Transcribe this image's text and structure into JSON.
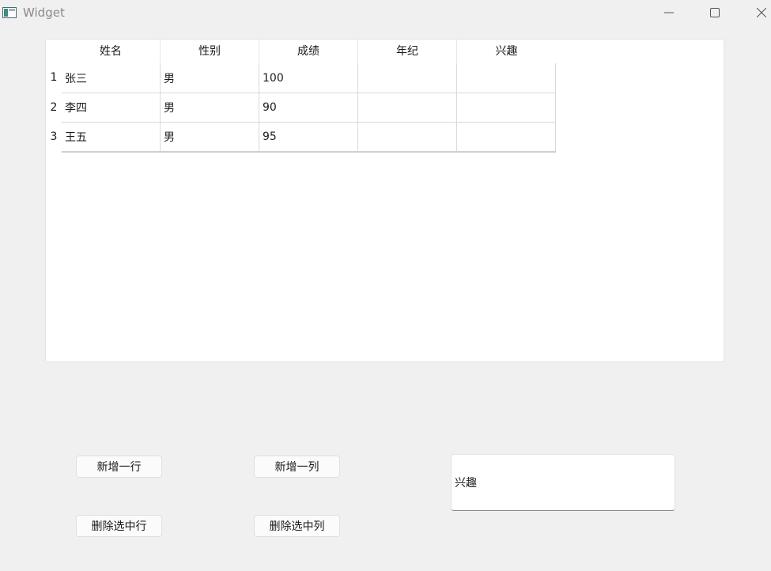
{
  "window": {
    "title": "Widget",
    "controls": [
      "minimize-icon",
      "maximize-icon",
      "close-icon"
    ]
  },
  "table": {
    "columns": [
      "姓名",
      "性别",
      "成绩",
      "年纪",
      "兴趣"
    ],
    "row_numbers": [
      "1",
      "2",
      "3"
    ],
    "rows": [
      [
        "张三",
        "男",
        "100",
        "",
        ""
      ],
      [
        "李四",
        "男",
        "90",
        "",
        ""
      ],
      [
        "王五",
        "男",
        "95",
        "",
        ""
      ]
    ]
  },
  "buttons": {
    "add_row": "新增一行",
    "add_column": "新增一列",
    "delete_row": "删除选中行",
    "delete_column": "删除选中列"
  },
  "input": {
    "value": "兴趣"
  }
}
